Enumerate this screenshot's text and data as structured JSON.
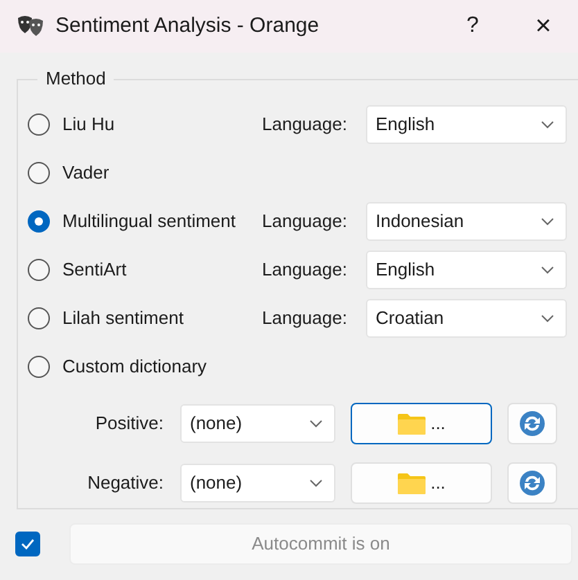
{
  "window": {
    "title": "Sentiment Analysis - Orange",
    "help": "?",
    "close": "×"
  },
  "method": {
    "title": "Method",
    "options": [
      {
        "kind": "language",
        "label": "Liu Hu",
        "selected": false,
        "language_label": "Language:",
        "language": "English"
      },
      {
        "kind": "plain",
        "label": "Vader",
        "selected": false
      },
      {
        "kind": "language",
        "label": "Multilingual sentiment",
        "selected": true,
        "language_label": "Language:",
        "language": "Indonesian"
      },
      {
        "kind": "language",
        "label": "SentiArt",
        "selected": false,
        "language_label": "Language:",
        "language": "English"
      },
      {
        "kind": "language",
        "label": "Lilah sentiment",
        "selected": false,
        "language_label": "Language:",
        "language": "Croatian"
      },
      {
        "kind": "plain",
        "label": "Custom dictionary",
        "selected": false
      }
    ],
    "dictionaries": [
      {
        "label": "Positive:",
        "file": "(none)",
        "browse": "...",
        "focused": true
      },
      {
        "label": "Negative:",
        "file": "(none)",
        "browse": "...",
        "focused": false
      }
    ]
  },
  "autocommit": {
    "checked": true,
    "label": "Autocommit is on"
  }
}
